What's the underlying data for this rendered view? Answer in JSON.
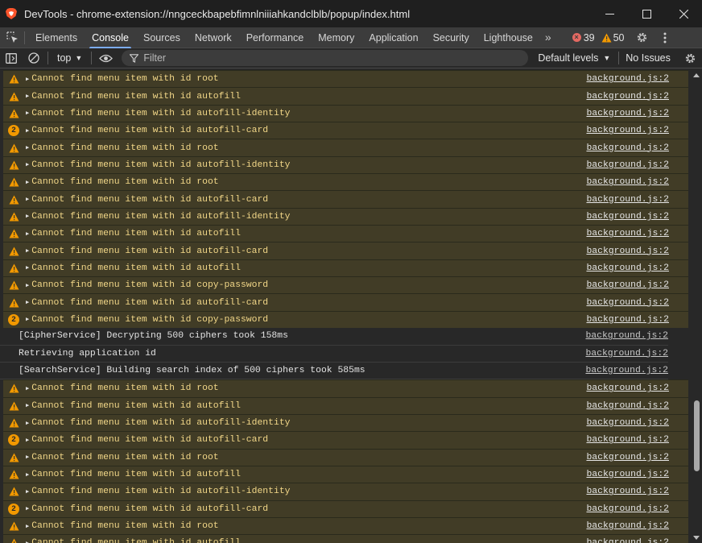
{
  "window": {
    "title": "DevTools - chrome-extension://nngceckbapebfimnlniiiahkandclblb/popup/index.html",
    "minimize": "—",
    "maximize": "☐",
    "close": "✕"
  },
  "tabs": [
    {
      "label": "Elements",
      "active": false
    },
    {
      "label": "Console",
      "active": true
    },
    {
      "label": "Sources",
      "active": false
    },
    {
      "label": "Network",
      "active": false
    },
    {
      "label": "Performance",
      "active": false
    },
    {
      "label": "Memory",
      "active": false
    },
    {
      "label": "Application",
      "active": false
    },
    {
      "label": "Security",
      "active": false
    },
    {
      "label": "Lighthouse",
      "active": false
    }
  ],
  "tab_more": "»",
  "counts": {
    "errors": "39",
    "warnings": "50"
  },
  "toolbar": {
    "context": "top",
    "filter_placeholder": "Filter",
    "levels": "Default levels",
    "issues": "No Issues"
  },
  "colors": {
    "warn_bg": "#413c26",
    "warn_text": "#f2d788",
    "accent": "#7cacf8",
    "repeat_badge": "#f29900"
  },
  "messages": [
    {
      "type": "warn",
      "text": "Cannot find menu item with id root",
      "source": "background.js:2"
    },
    {
      "type": "warn",
      "text": "Cannot find menu item with id autofill",
      "source": "background.js:2"
    },
    {
      "type": "warn",
      "text": "Cannot find menu item with id autofill-identity",
      "source": "background.js:2"
    },
    {
      "type": "warn",
      "count": "2",
      "text": "Cannot find menu item with id autofill-card",
      "source": "background.js:2"
    },
    {
      "type": "warn",
      "text": "Cannot find menu item with id root",
      "source": "background.js:2"
    },
    {
      "type": "warn",
      "text": "Cannot find menu item with id autofill-identity",
      "source": "background.js:2"
    },
    {
      "type": "warn",
      "text": "Cannot find menu item with id root",
      "source": "background.js:2"
    },
    {
      "type": "warn",
      "text": "Cannot find menu item with id autofill-card",
      "source": "background.js:2"
    },
    {
      "type": "warn",
      "text": "Cannot find menu item with id autofill-identity",
      "source": "background.js:2"
    },
    {
      "type": "warn",
      "text": "Cannot find menu item with id autofill",
      "source": "background.js:2"
    },
    {
      "type": "warn",
      "text": "Cannot find menu item with id autofill-card",
      "source": "background.js:2"
    },
    {
      "type": "warn",
      "text": "Cannot find menu item with id autofill",
      "source": "background.js:2"
    },
    {
      "type": "warn",
      "text": "Cannot find menu item with id copy-password",
      "source": "background.js:2"
    },
    {
      "type": "warn",
      "text": "Cannot find menu item with id autofill-card",
      "source": "background.js:2"
    },
    {
      "type": "warn",
      "count": "2",
      "text": "Cannot find menu item with id copy-password",
      "source": "background.js:2"
    },
    {
      "type": "log",
      "text": "[CipherService] Decrypting 500 ciphers took 158ms",
      "source": "background.js:2"
    },
    {
      "type": "log",
      "text": "Retrieving application id",
      "source": "background.js:2"
    },
    {
      "type": "log",
      "text": "[SearchService] Building search index of 500 ciphers took 585ms",
      "source": "background.js:2"
    },
    {
      "type": "warn",
      "text": "Cannot find menu item with id root",
      "source": "background.js:2"
    },
    {
      "type": "warn",
      "text": "Cannot find menu item with id autofill",
      "source": "background.js:2"
    },
    {
      "type": "warn",
      "text": "Cannot find menu item with id autofill-identity",
      "source": "background.js:2"
    },
    {
      "type": "warn",
      "count": "2",
      "text": "Cannot find menu item with id autofill-card",
      "source": "background.js:2"
    },
    {
      "type": "warn",
      "text": "Cannot find menu item with id root",
      "source": "background.js:2"
    },
    {
      "type": "warn",
      "text": "Cannot find menu item with id autofill",
      "source": "background.js:2"
    },
    {
      "type": "warn",
      "text": "Cannot find menu item with id autofill-identity",
      "source": "background.js:2"
    },
    {
      "type": "warn",
      "count": "2",
      "text": "Cannot find menu item with id autofill-card",
      "source": "background.js:2"
    },
    {
      "type": "warn",
      "text": "Cannot find menu item with id root",
      "source": "background.js:2"
    },
    {
      "type": "warn",
      "text": "Cannot find menu item with id autofill",
      "source": "background.js:2"
    }
  ]
}
